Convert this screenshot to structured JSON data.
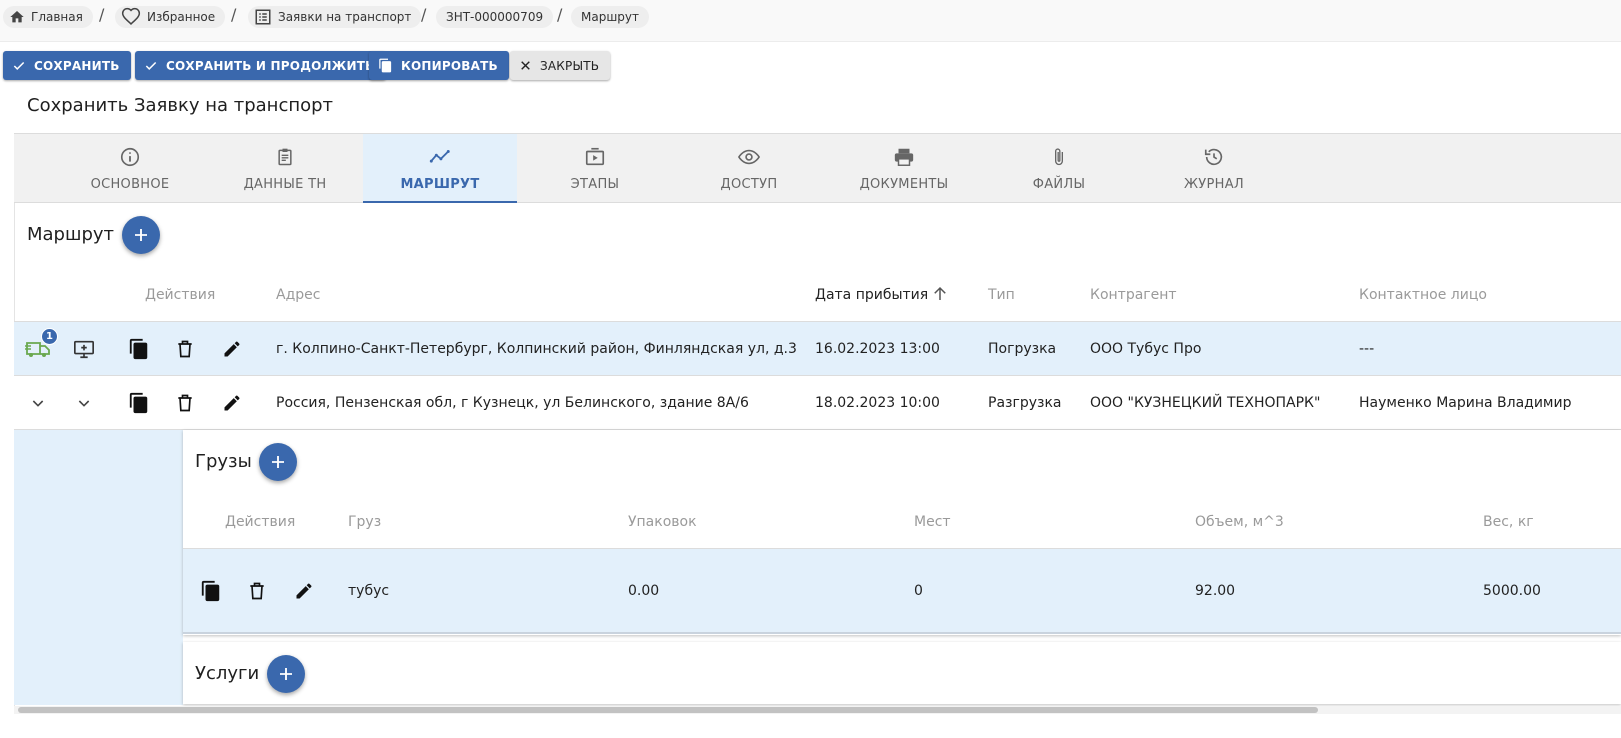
{
  "breadcrumbs": [
    {
      "label": "Главная",
      "icon": "home-icon"
    },
    {
      "label": "Избранное",
      "icon": "heart-icon"
    },
    {
      "label": "Заявки на транспорт",
      "icon": "list-icon"
    },
    {
      "label": "ЗНТ-000000709"
    },
    {
      "label": "Маршрут"
    }
  ],
  "breadcrumb_separator": "/",
  "toolbar": {
    "save": "СОХРАНИТЬ",
    "save_continue": "СОХРАНИТЬ И ПРОДОЛЖИТЬ",
    "copy": "КОПИРОВАТЬ",
    "close": "ЗАКРЫТЬ"
  },
  "page_title": "Сохранить Заявку на транспорт",
  "tabs": [
    {
      "label": "ОСНОВНОЕ",
      "icon": "info-icon"
    },
    {
      "label": "ДАННЫЕ ТН",
      "icon": "clipboard-icon"
    },
    {
      "label": "МАРШРУТ",
      "icon": "route-icon",
      "active": true
    },
    {
      "label": "ЭТАПЫ",
      "icon": "stages-icon"
    },
    {
      "label": "ДОСТУП",
      "icon": "eye-icon"
    },
    {
      "label": "ДОКУМЕНТЫ",
      "icon": "printer-icon"
    },
    {
      "label": "ФАЙЛЫ",
      "icon": "paperclip-icon"
    },
    {
      "label": "ЖУРНАЛ",
      "icon": "history-icon"
    }
  ],
  "route": {
    "title": "Маршрут",
    "columns": {
      "actions": "Действия",
      "address": "Адрес",
      "arrival": "Дата прибытия",
      "type": "Тип",
      "counterparty": "Контрагент",
      "contact": "Контактное лицо"
    },
    "rows": [
      {
        "badge": "1",
        "address": "г. Колпино-Санкт-Петербург, Колпинский район, Финляндская ул, д.3",
        "arrival": "16.02.2023 13:00",
        "type": "Погрузка",
        "counterparty": "ООО Тубус Про",
        "contact": "---"
      },
      {
        "address": "Россия, Пензенская обл, г Кузнецк, ул Белинского, здание 8А/6",
        "arrival": "18.02.2023 10:00",
        "type": "Разгрузка",
        "counterparty": "ООО \"КУЗНЕЦКИЙ ТЕХНОПАРК\"",
        "contact": "Науменко Марина Владимир"
      }
    ]
  },
  "cargo": {
    "title": "Грузы",
    "columns": {
      "actions": "Действия",
      "name": "Груз",
      "packages": "Упаковок",
      "places": "Мест",
      "volume": "Объем, м^3",
      "weight": "Вес, кг"
    },
    "rows": [
      {
        "name": "тубус",
        "packages": "0.00",
        "places": "0",
        "volume": "92.00",
        "weight": "5000.00"
      }
    ]
  },
  "services": {
    "title": "Услуги"
  },
  "colors": {
    "primary": "#3a68ad",
    "selected_row": "#e3f0fb",
    "truck_icon": "#6aa84f"
  }
}
